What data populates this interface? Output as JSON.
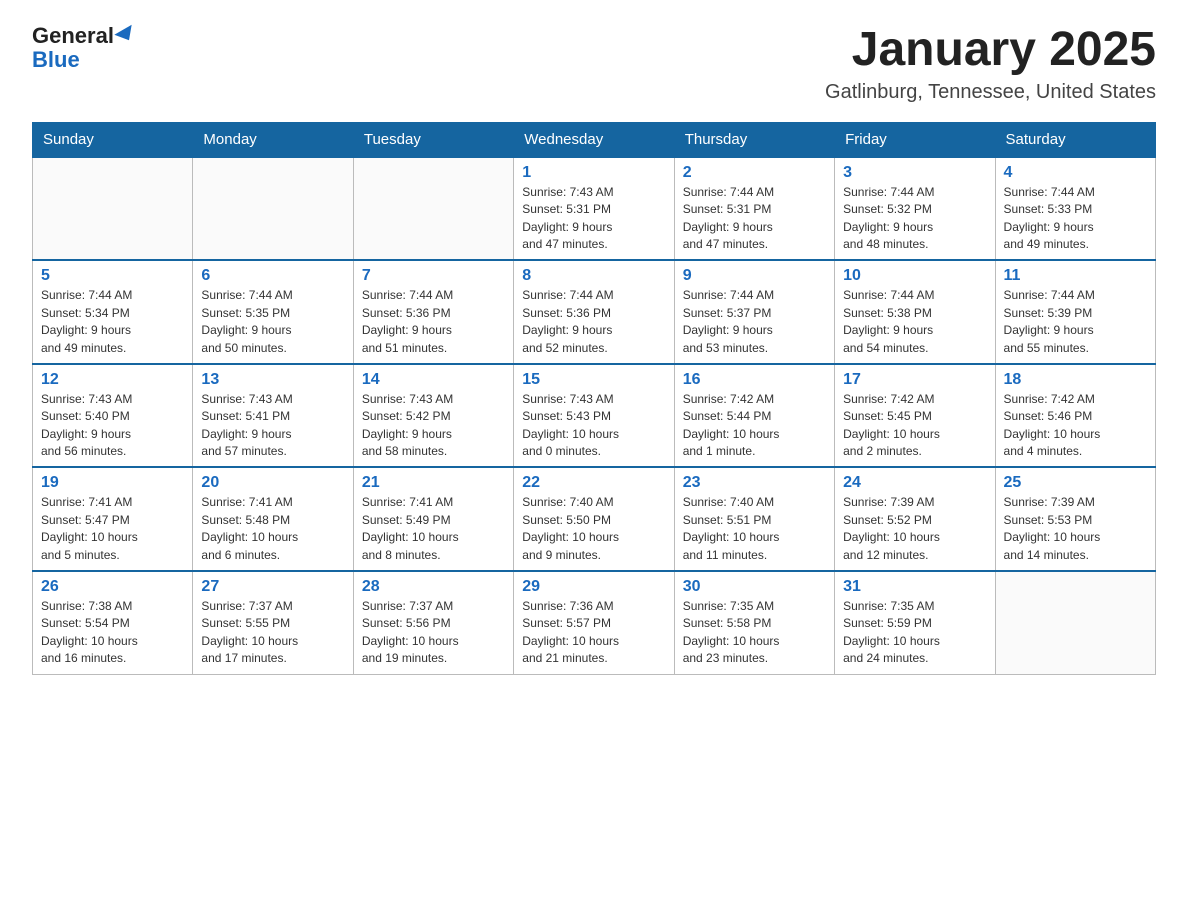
{
  "header": {
    "logo_text_general": "General",
    "logo_text_blue": "Blue",
    "month_title": "January 2025",
    "location": "Gatlinburg, Tennessee, United States"
  },
  "days_of_week": [
    "Sunday",
    "Monday",
    "Tuesday",
    "Wednesday",
    "Thursday",
    "Friday",
    "Saturday"
  ],
  "weeks": [
    [
      {
        "day": "",
        "info": ""
      },
      {
        "day": "",
        "info": ""
      },
      {
        "day": "",
        "info": ""
      },
      {
        "day": "1",
        "info": "Sunrise: 7:43 AM\nSunset: 5:31 PM\nDaylight: 9 hours\nand 47 minutes."
      },
      {
        "day": "2",
        "info": "Sunrise: 7:44 AM\nSunset: 5:31 PM\nDaylight: 9 hours\nand 47 minutes."
      },
      {
        "day": "3",
        "info": "Sunrise: 7:44 AM\nSunset: 5:32 PM\nDaylight: 9 hours\nand 48 minutes."
      },
      {
        "day": "4",
        "info": "Sunrise: 7:44 AM\nSunset: 5:33 PM\nDaylight: 9 hours\nand 49 minutes."
      }
    ],
    [
      {
        "day": "5",
        "info": "Sunrise: 7:44 AM\nSunset: 5:34 PM\nDaylight: 9 hours\nand 49 minutes."
      },
      {
        "day": "6",
        "info": "Sunrise: 7:44 AM\nSunset: 5:35 PM\nDaylight: 9 hours\nand 50 minutes."
      },
      {
        "day": "7",
        "info": "Sunrise: 7:44 AM\nSunset: 5:36 PM\nDaylight: 9 hours\nand 51 minutes."
      },
      {
        "day": "8",
        "info": "Sunrise: 7:44 AM\nSunset: 5:36 PM\nDaylight: 9 hours\nand 52 minutes."
      },
      {
        "day": "9",
        "info": "Sunrise: 7:44 AM\nSunset: 5:37 PM\nDaylight: 9 hours\nand 53 minutes."
      },
      {
        "day": "10",
        "info": "Sunrise: 7:44 AM\nSunset: 5:38 PM\nDaylight: 9 hours\nand 54 minutes."
      },
      {
        "day": "11",
        "info": "Sunrise: 7:44 AM\nSunset: 5:39 PM\nDaylight: 9 hours\nand 55 minutes."
      }
    ],
    [
      {
        "day": "12",
        "info": "Sunrise: 7:43 AM\nSunset: 5:40 PM\nDaylight: 9 hours\nand 56 minutes."
      },
      {
        "day": "13",
        "info": "Sunrise: 7:43 AM\nSunset: 5:41 PM\nDaylight: 9 hours\nand 57 minutes."
      },
      {
        "day": "14",
        "info": "Sunrise: 7:43 AM\nSunset: 5:42 PM\nDaylight: 9 hours\nand 58 minutes."
      },
      {
        "day": "15",
        "info": "Sunrise: 7:43 AM\nSunset: 5:43 PM\nDaylight: 10 hours\nand 0 minutes."
      },
      {
        "day": "16",
        "info": "Sunrise: 7:42 AM\nSunset: 5:44 PM\nDaylight: 10 hours\nand 1 minute."
      },
      {
        "day": "17",
        "info": "Sunrise: 7:42 AM\nSunset: 5:45 PM\nDaylight: 10 hours\nand 2 minutes."
      },
      {
        "day": "18",
        "info": "Sunrise: 7:42 AM\nSunset: 5:46 PM\nDaylight: 10 hours\nand 4 minutes."
      }
    ],
    [
      {
        "day": "19",
        "info": "Sunrise: 7:41 AM\nSunset: 5:47 PM\nDaylight: 10 hours\nand 5 minutes."
      },
      {
        "day": "20",
        "info": "Sunrise: 7:41 AM\nSunset: 5:48 PM\nDaylight: 10 hours\nand 6 minutes."
      },
      {
        "day": "21",
        "info": "Sunrise: 7:41 AM\nSunset: 5:49 PM\nDaylight: 10 hours\nand 8 minutes."
      },
      {
        "day": "22",
        "info": "Sunrise: 7:40 AM\nSunset: 5:50 PM\nDaylight: 10 hours\nand 9 minutes."
      },
      {
        "day": "23",
        "info": "Sunrise: 7:40 AM\nSunset: 5:51 PM\nDaylight: 10 hours\nand 11 minutes."
      },
      {
        "day": "24",
        "info": "Sunrise: 7:39 AM\nSunset: 5:52 PM\nDaylight: 10 hours\nand 12 minutes."
      },
      {
        "day": "25",
        "info": "Sunrise: 7:39 AM\nSunset: 5:53 PM\nDaylight: 10 hours\nand 14 minutes."
      }
    ],
    [
      {
        "day": "26",
        "info": "Sunrise: 7:38 AM\nSunset: 5:54 PM\nDaylight: 10 hours\nand 16 minutes."
      },
      {
        "day": "27",
        "info": "Sunrise: 7:37 AM\nSunset: 5:55 PM\nDaylight: 10 hours\nand 17 minutes."
      },
      {
        "day": "28",
        "info": "Sunrise: 7:37 AM\nSunset: 5:56 PM\nDaylight: 10 hours\nand 19 minutes."
      },
      {
        "day": "29",
        "info": "Sunrise: 7:36 AM\nSunset: 5:57 PM\nDaylight: 10 hours\nand 21 minutes."
      },
      {
        "day": "30",
        "info": "Sunrise: 7:35 AM\nSunset: 5:58 PM\nDaylight: 10 hours\nand 23 minutes."
      },
      {
        "day": "31",
        "info": "Sunrise: 7:35 AM\nSunset: 5:59 PM\nDaylight: 10 hours\nand 24 minutes."
      },
      {
        "day": "",
        "info": ""
      }
    ]
  ]
}
